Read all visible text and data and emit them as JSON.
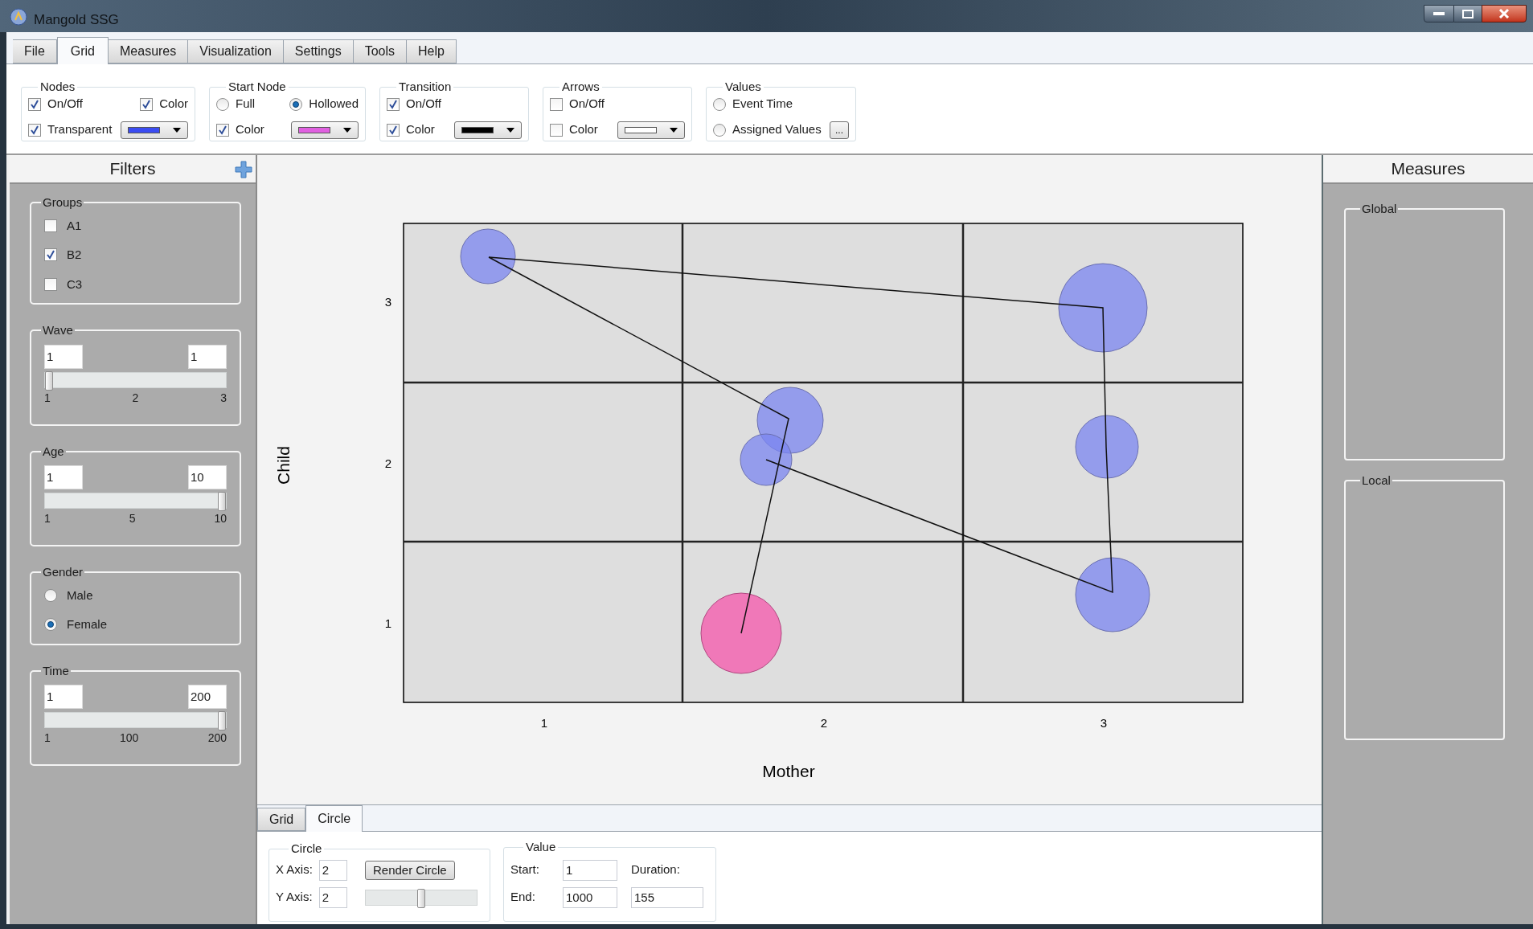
{
  "window": {
    "title": "Mangold SSG"
  },
  "menu_tabs": [
    {
      "label": "File",
      "selected": false
    },
    {
      "label": "Grid",
      "selected": true
    },
    {
      "label": "Measures",
      "selected": false
    },
    {
      "label": "Visualization",
      "selected": false
    },
    {
      "label": "Settings",
      "selected": false
    },
    {
      "label": "Tools",
      "selected": false
    },
    {
      "label": "Help",
      "selected": false
    }
  ],
  "toolbar": [
    {
      "title": "Nodes",
      "rows": [
        [
          {
            "kind": "checkbox",
            "label": "On/Off",
            "checked": true
          },
          {
            "kind": "checkbox",
            "label": "Color",
            "checked": true
          }
        ],
        [
          {
            "kind": "checkbox",
            "label": "Transparent",
            "checked": true
          },
          {
            "kind": "color_picker",
            "color": "#3b4cf2"
          }
        ]
      ]
    },
    {
      "title": "Start Node",
      "rows": [
        [
          {
            "kind": "radio",
            "label": "Full",
            "selected": false
          },
          {
            "kind": "radio",
            "label": "Hollowed",
            "selected": true
          }
        ],
        [
          {
            "kind": "checkbox",
            "label": "Color",
            "checked": true
          },
          {
            "kind": "color_picker",
            "color": "#e060e0"
          }
        ]
      ]
    },
    {
      "title": "Transition",
      "rows": [
        [
          {
            "kind": "checkbox",
            "label": "On/Off",
            "checked": true
          }
        ],
        [
          {
            "kind": "checkbox",
            "label": "Color",
            "checked": true
          },
          {
            "kind": "color_picker",
            "color": "#000000"
          }
        ]
      ]
    },
    {
      "title": "Arrows",
      "rows": [
        [
          {
            "kind": "checkbox",
            "label": "On/Off",
            "checked": false
          }
        ],
        [
          {
            "kind": "checkbox",
            "label": "Color",
            "checked": false
          },
          {
            "kind": "color_picker",
            "color": "#ffffff"
          }
        ]
      ]
    },
    {
      "title": "Values",
      "rows": [
        [
          {
            "kind": "radio",
            "label": "Event Time",
            "selected": false
          }
        ],
        [
          {
            "kind": "radio",
            "label": "Assigned Values",
            "selected": false
          },
          {
            "kind": "button",
            "label": "..."
          }
        ]
      ]
    }
  ],
  "filters": {
    "title": "Filters",
    "groups": [
      {
        "kind": "checklist",
        "title": "Groups",
        "items": [
          {
            "label": "A1",
            "checked": false
          },
          {
            "label": "B2",
            "checked": true
          },
          {
            "label": "C3",
            "checked": false
          }
        ]
      },
      {
        "kind": "range",
        "title": "Wave",
        "from": "1",
        "to": "1",
        "level": 0,
        "ticks": [
          "1",
          "2",
          "3"
        ]
      },
      {
        "kind": "range",
        "title": "Age",
        "from": "1",
        "to": "10",
        "level": 1,
        "ticks": [
          "1",
          "5",
          "10"
        ]
      },
      {
        "kind": "radiolist",
        "title": "Gender",
        "items": [
          {
            "label": "Male",
            "selected": false
          },
          {
            "label": "Female",
            "selected": true
          }
        ]
      },
      {
        "kind": "range",
        "title": "Time",
        "from": "1",
        "to": "200",
        "level": 1,
        "ticks": [
          "1",
          "100",
          "200"
        ]
      }
    ]
  },
  "plot": {
    "xlabel": "Mother",
    "ylabel": "Child",
    "x_ticks": [
      "1",
      "2",
      "3"
    ],
    "y_ticks": [
      "3",
      "2",
      "1"
    ]
  },
  "bottom_tabs": [
    {
      "label": "Grid",
      "selected": false
    },
    {
      "label": "Circle",
      "selected": true
    }
  ],
  "circle": {
    "title": "Circle",
    "x_label": "X Axis:",
    "x_value": "2",
    "y_label": "Y Axis:",
    "y_value": "2",
    "button": "Render Circle",
    "level": 0.5
  },
  "value": {
    "title": "Value",
    "start_label": "Start:",
    "start": "1",
    "duration_label": "Duration:",
    "end_label": "End:",
    "end": "1000",
    "duration": "155"
  },
  "measures": {
    "title": "Measures",
    "sections": [
      "Global",
      "Local"
    ]
  }
}
